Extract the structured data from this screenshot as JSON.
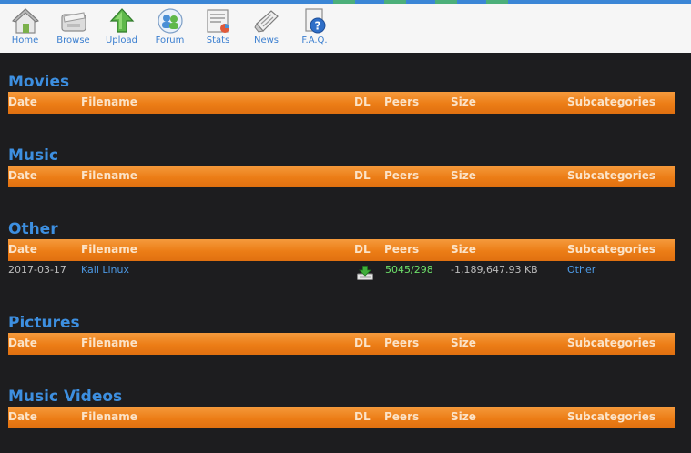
{
  "nav": {
    "items": [
      {
        "label": "Home",
        "icon": "home-icon"
      },
      {
        "label": "Browse",
        "icon": "browse-icon"
      },
      {
        "label": "Upload",
        "icon": "upload-icon"
      },
      {
        "label": "Forum",
        "icon": "forum-icon"
      },
      {
        "label": "Stats",
        "icon": "stats-icon"
      },
      {
        "label": "News",
        "icon": "news-icon"
      },
      {
        "label": "F.A.Q.",
        "icon": "faq-icon"
      }
    ]
  },
  "columns": {
    "date": "Date",
    "filename": "Filename",
    "dl": "DL",
    "peers": "Peers",
    "size": "Size",
    "subcategories": "Subcategories"
  },
  "sections": [
    {
      "title": "Movies",
      "rows": []
    },
    {
      "title": "Music",
      "rows": []
    },
    {
      "title": "Other",
      "rows": [
        {
          "date": "2017-03-17",
          "filename": "Kali Linux",
          "peers": "5045/298",
          "size": "-1,189,647.93 KB",
          "subcategory": "Other",
          "dl_icon": "download-icon"
        }
      ]
    },
    {
      "title": "Pictures",
      "rows": []
    },
    {
      "title": "Music Videos",
      "rows": []
    }
  ],
  "colors": {
    "accent_blue": "#3d8fe0",
    "header_orange": "#ec7d16",
    "background": "#1d1d1f",
    "peers_green": "#6ee06a"
  }
}
